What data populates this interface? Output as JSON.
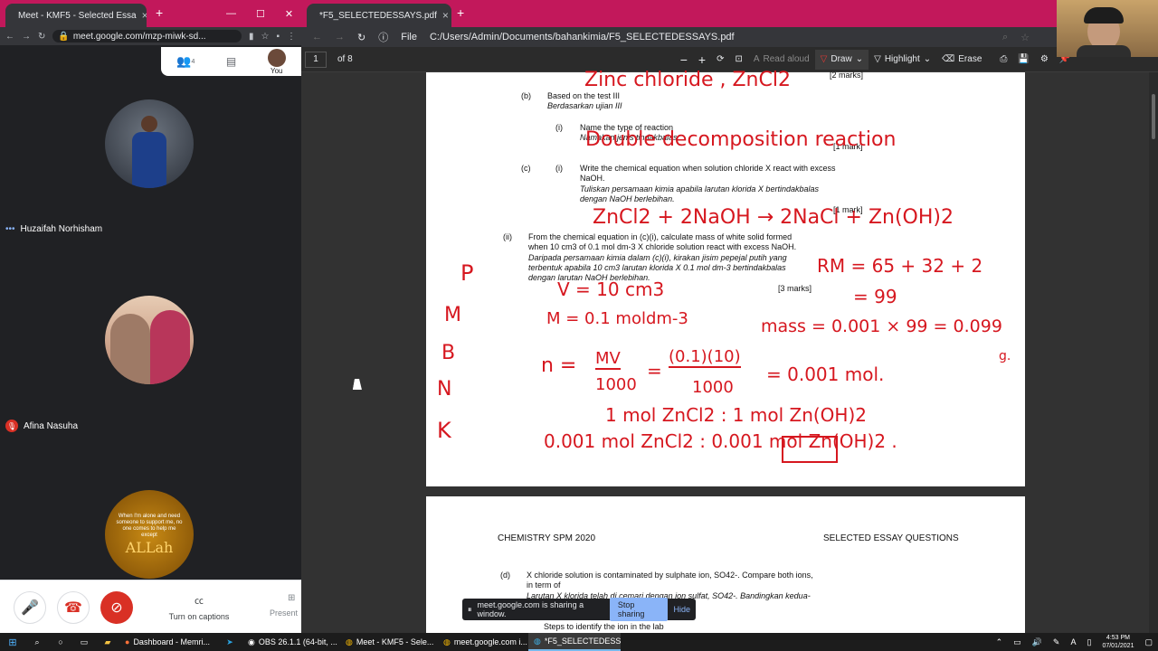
{
  "left_browser": {
    "tab_title": "Meet - KMF5 - Selected Essa",
    "new_tab": "+",
    "url": "meet.google.com/mzp-miwk-sd...",
    "meet_top": {
      "people_count": "4",
      "you_label": "You"
    }
  },
  "participants": [
    {
      "name": "Huzaifah Norhisham"
    },
    {
      "name": "Afina Nasuha"
    },
    {
      "quote": "When I'm alone and need someone to support me, no one comes to help me except",
      "quote_word": "ALLah"
    }
  ],
  "meet_controls": {
    "captions_label": "Turn on captions",
    "present_label": "Present"
  },
  "pdf_browser": {
    "tab_title": "*F5_SELECTEDESSAYS.pdf",
    "file_label": "File",
    "path": "C:/Users/Admin/Documents/bahankimia/F5_SELECTEDESSAYS.pdf",
    "page_num": "1",
    "page_total": "of 8",
    "read_aloud": "Read aloud",
    "draw": "Draw",
    "highlight": "Highlight",
    "erase": "Erase"
  },
  "page1": {
    "marks_top": "[2 marks]",
    "b_label": "(b)",
    "b_text": "Based on the test III",
    "b_text_ms": "Berdasarkan ujian III",
    "i_label": "(i)",
    "i_text": "Name the type of reaction",
    "i_text_ms": "Namakan jenis tindakbalas",
    "marks_1a": "[1 mark]",
    "c_label": "(c)",
    "c_i_label": "(i)",
    "c_text": "Write the chemical equation when solution chloride X react with excess",
    "c_text2": "NaOH.",
    "c_text_ms": "Tuliskan persamaan kimia apabila larutan klorida X bertindakbalas",
    "c_text_ms2": "dengan NaOH berlebihan.",
    "marks_1b": "[1 mark]",
    "ii_label": "(ii)",
    "ii_text": "From the chemical equation in (c)(i), calculate mass of white solid formed",
    "ii_text2": "when 10 cm3 of 0.1 mol dm-3 X chloride solution react with excess NaOH.",
    "ii_ms": "Daripada persamaan kimia dalam (c)(i), kirakan jisim pepejal putih yang",
    "ii_ms2": "terbentuk apabila 10 cm3 larutan klorida X 0.1 mol dm-3 bertindakbalas",
    "ii_ms3": "dengan larutan NaOH berlebihan.",
    "marks_3": "[3 marks]"
  },
  "handwriting": {
    "l1": "Zinc chloride , ZnCl2",
    "l2": "Double decomposition reaction",
    "l3": "ZnCl2 + 2NaOH → 2NaCl + Zn(OH)2",
    "l4": "RM = 65 + 32 + 2",
    "l5": "= 99",
    "l6": "V = 10 cm3",
    "l7": "M = 0.1 moldm-3",
    "l8": "mass = 0.001 × 99 = 0.099",
    "l8b": "g.",
    "l9a": "n =",
    "l9b": "MV",
    "l9c": "1000",
    "l9d": "(0.1)(10)",
    "l9e": "1000",
    "l9f": "= 0.001 mol.",
    "l10": "1 mol ZnCl2 : 1 mol Zn(OH)2",
    "l11": "0.001 mol ZnCl2 : 0.001 mol Zn(OH)2 .",
    "pmbnk": [
      "P",
      "M",
      "B",
      "N",
      "K"
    ]
  },
  "page2": {
    "header_left": "CHEMISTRY SPM 2020",
    "header_right": "SELECTED ESSAY QUESTIONS",
    "d_label": "(d)",
    "d_text": "X chloride solution is contaminated by sulphate ion, SO42-. Compare both ions,",
    "d_text2": "in term of",
    "d_ms": "Larutan X klorida telah di cemari dengan ion sulfat, SO42-. Bandingkan kedua-",
    "d_bullet": "Steps to identify the ion in the lab"
  },
  "share_bar": {
    "text": "meet.google.com is sharing a window.",
    "stop": "Stop sharing",
    "hide": "Hide"
  },
  "taskbar": {
    "items": [
      "Dashboard - Memri...",
      "OBS 26.1.1 (64-bit, ...",
      "Meet - KMF5 - Sele...",
      "meet.google.com i...",
      "*F5_SELECTEDESSA..."
    ],
    "time": "4:53 PM",
    "date": "07/01/2021",
    "lang": "A"
  }
}
